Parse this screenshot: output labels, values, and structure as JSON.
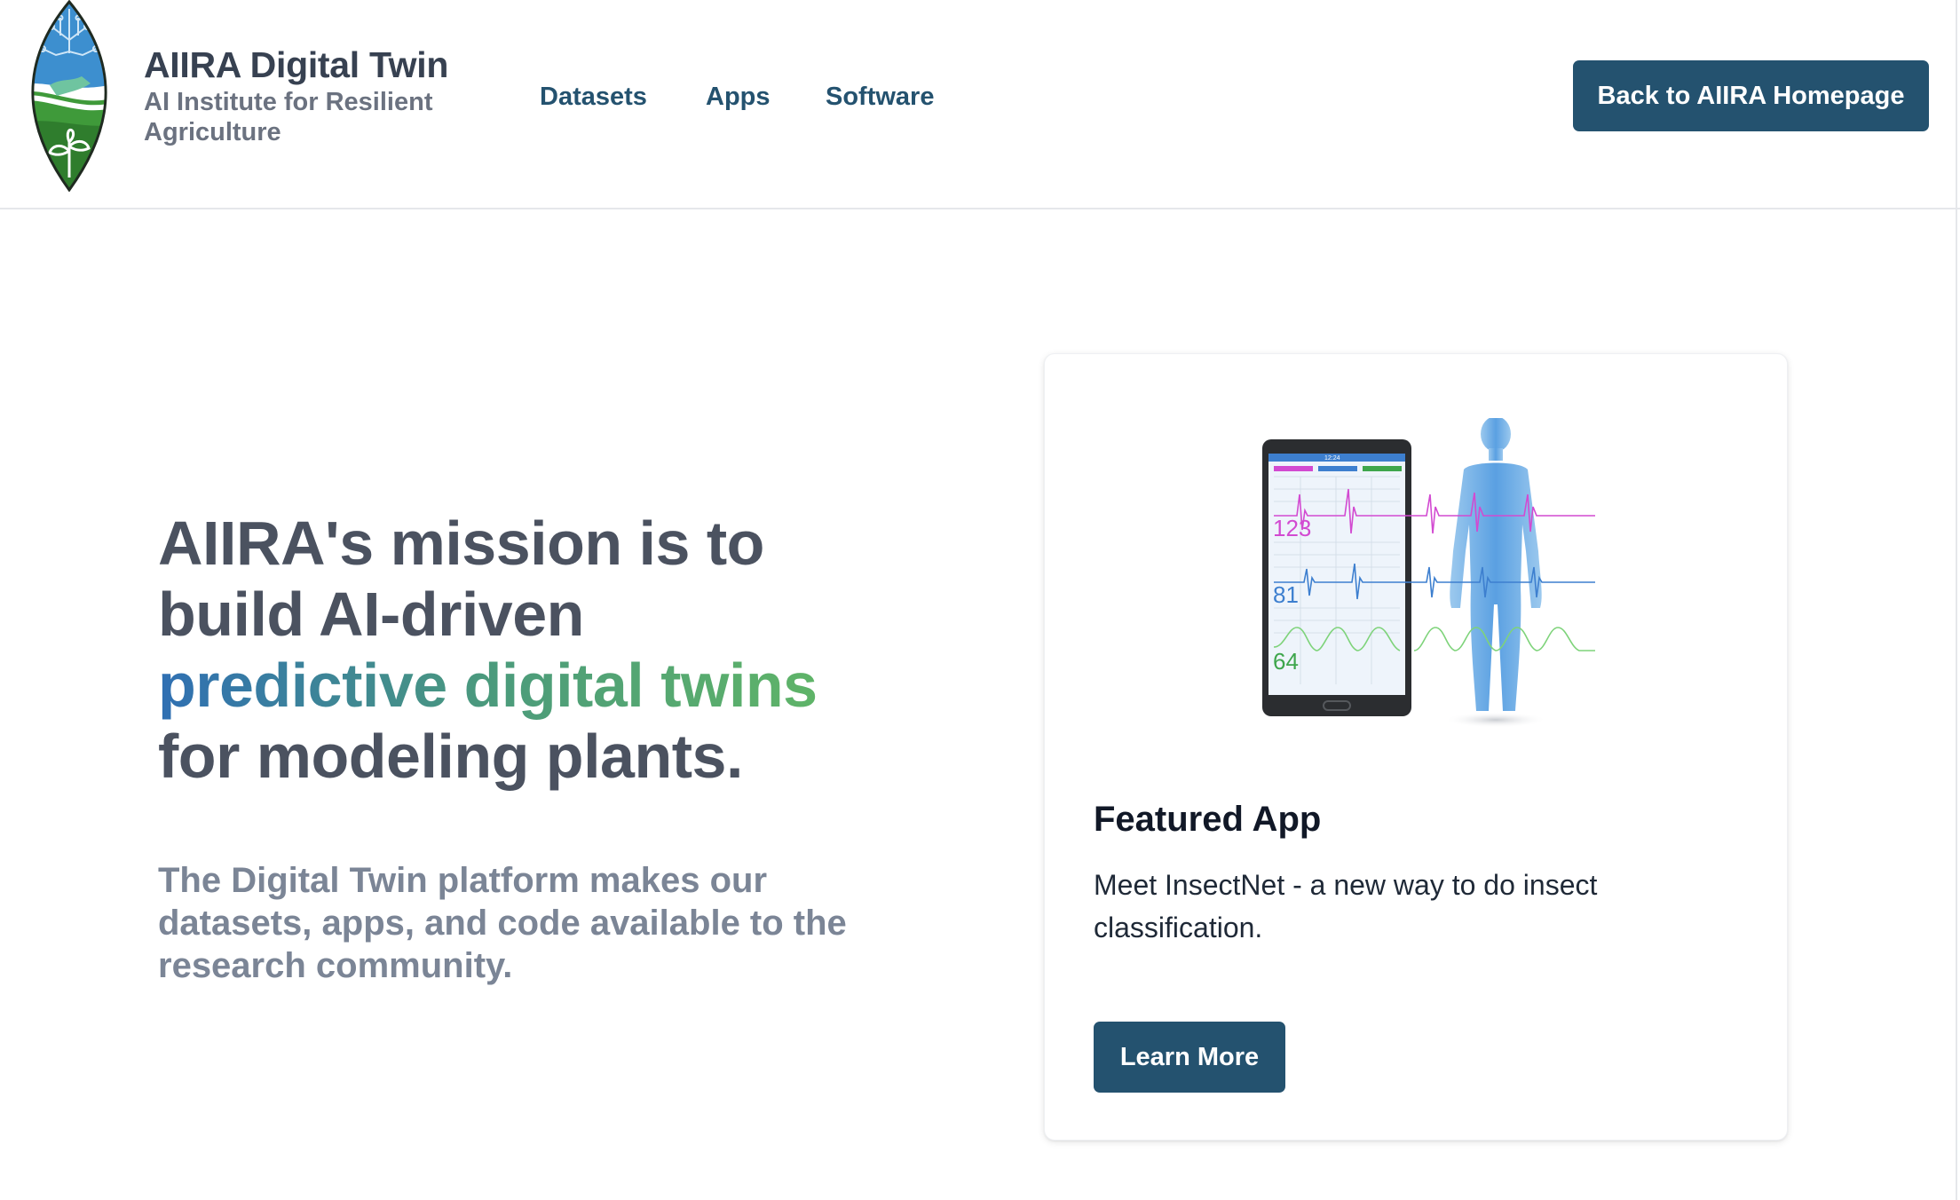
{
  "header": {
    "brand_title": "AIIRA Digital Twin",
    "brand_subtitle": "AI Institute for Resilient Agriculture",
    "nav": [
      "Datasets",
      "Apps",
      "Software"
    ],
    "home_button": "Back to AIIRA Homepage"
  },
  "hero": {
    "title_line1": "AIIRA's mission is to",
    "title_line2": "build AI-driven",
    "title_highlight": "predictive digital twins",
    "title_line4": "for modeling plants.",
    "description": "The Digital Twin platform makes our datasets, apps, and code available to the research community."
  },
  "featured": {
    "illustration": {
      "phone_time": "12:24",
      "readings": [
        "123",
        "81",
        "64"
      ]
    },
    "title": "Featured App",
    "text": "Meet InsectNet - a new way to do insect classification.",
    "button": "Learn More"
  },
  "colors": {
    "primary": "#24526f",
    "gradient_start": "#2f6fb3",
    "gradient_end": "#5fb468",
    "heading_gray": "#4b5260",
    "muted_gray": "#7b8596"
  }
}
